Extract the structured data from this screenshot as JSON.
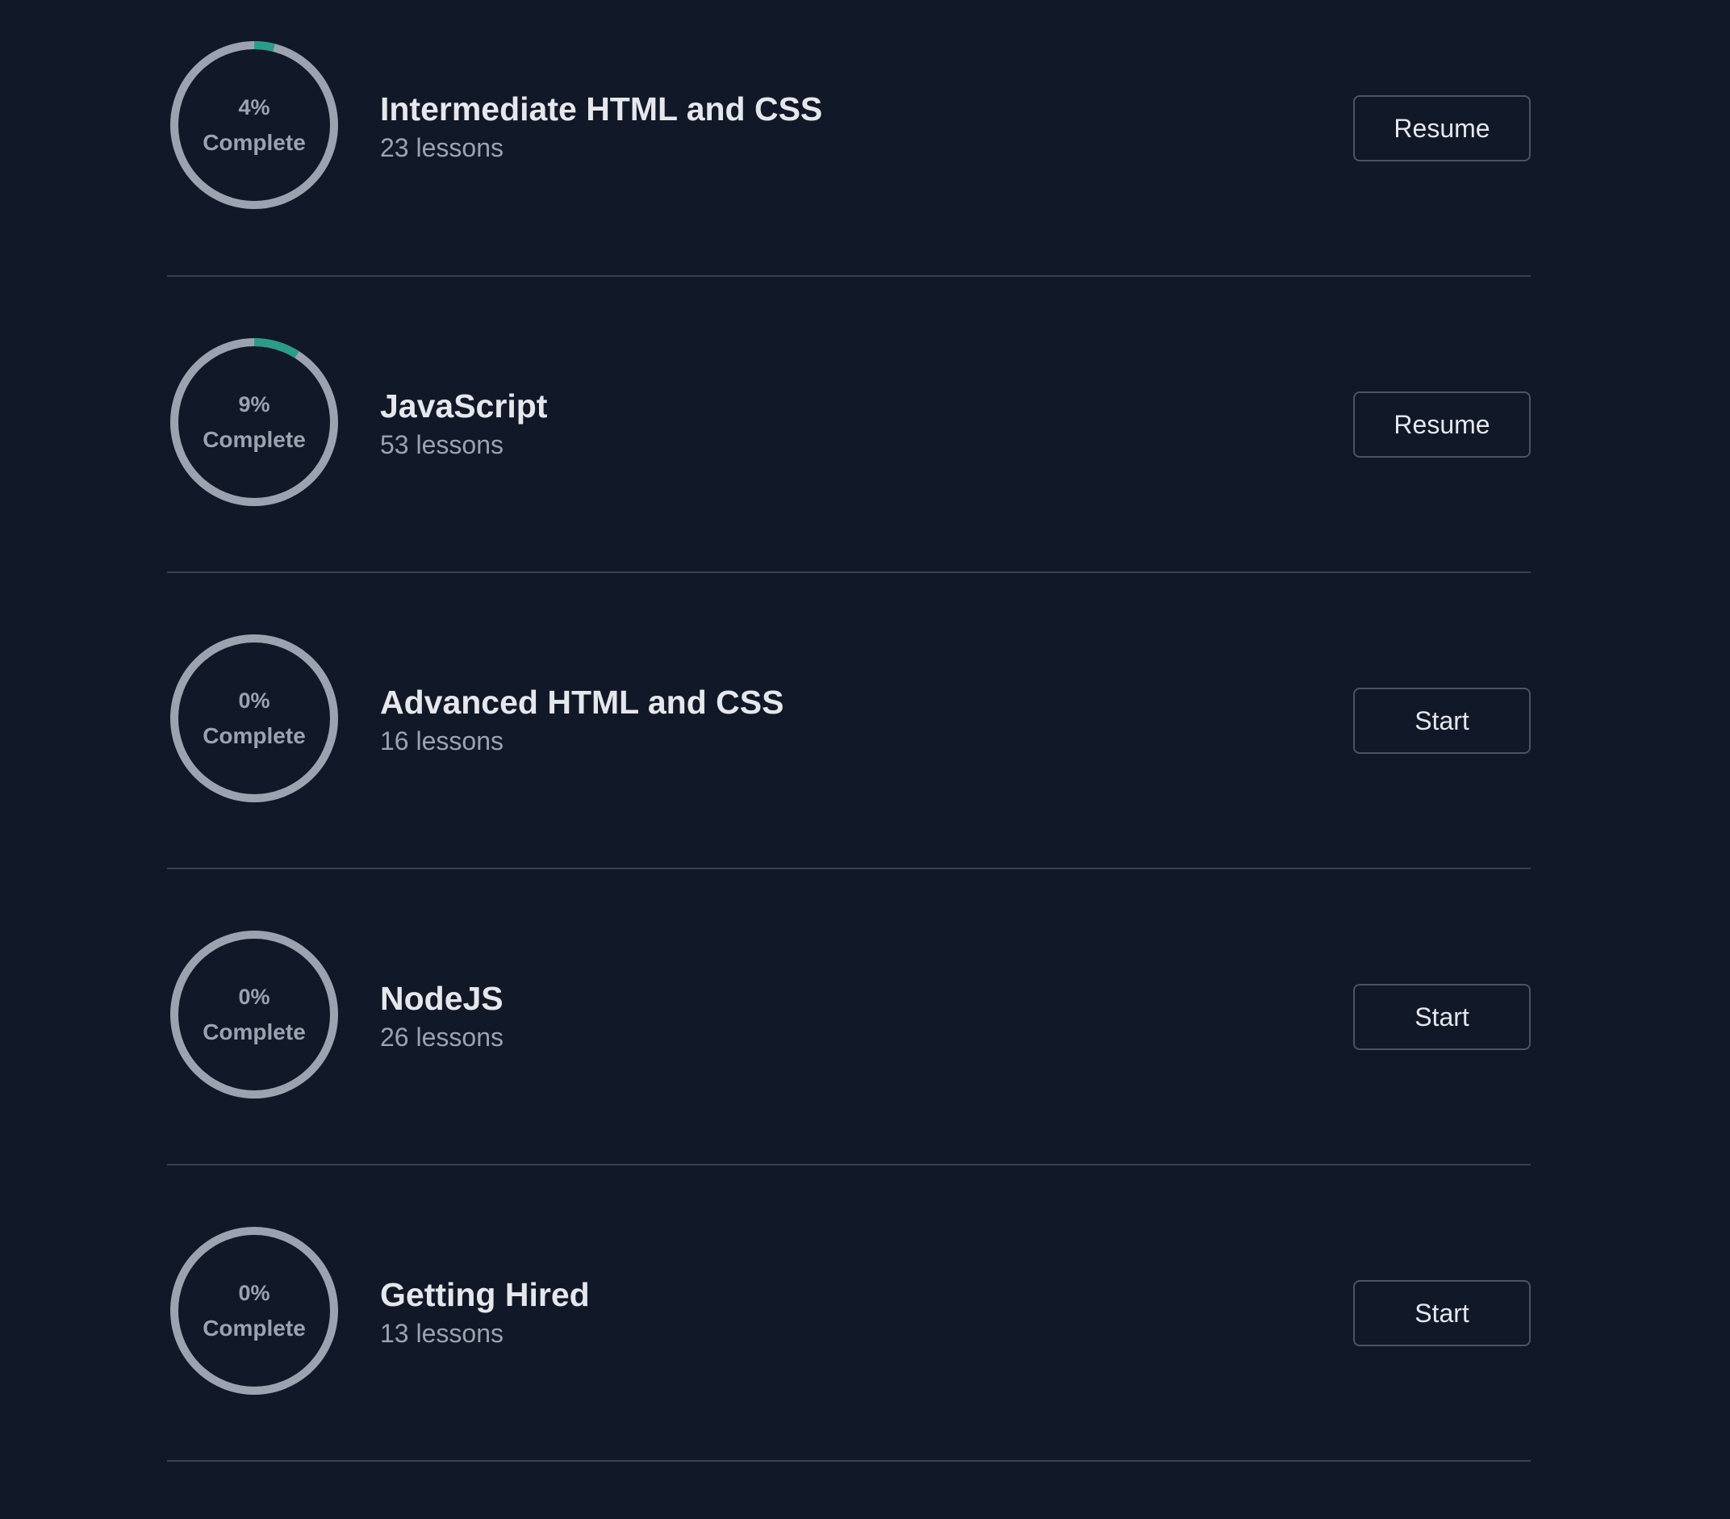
{
  "colors": {
    "background": "#111827",
    "ring_track": "#9ca3af",
    "ring_progress": "#2a9d8a",
    "divider": "#374151",
    "button_border": "#4b5563"
  },
  "courses": [
    {
      "title": "Intermediate HTML and CSS",
      "lessons": "23 lessons",
      "percent_text": "4%",
      "complete_label": "Complete",
      "progress": 0.04,
      "button_label": "Resume"
    },
    {
      "title": "JavaScript",
      "lessons": "53 lessons",
      "percent_text": "9%",
      "complete_label": "Complete",
      "progress": 0.09,
      "button_label": "Resume"
    },
    {
      "title": "Advanced HTML and CSS",
      "lessons": "16 lessons",
      "percent_text": "0%",
      "complete_label": "Complete",
      "progress": 0,
      "button_label": "Start"
    },
    {
      "title": "NodeJS",
      "lessons": "26 lessons",
      "percent_text": "0%",
      "complete_label": "Complete",
      "progress": 0,
      "button_label": "Start"
    },
    {
      "title": "Getting Hired",
      "lessons": "13 lessons",
      "percent_text": "0%",
      "complete_label": "Complete",
      "progress": 0,
      "button_label": "Start"
    }
  ]
}
